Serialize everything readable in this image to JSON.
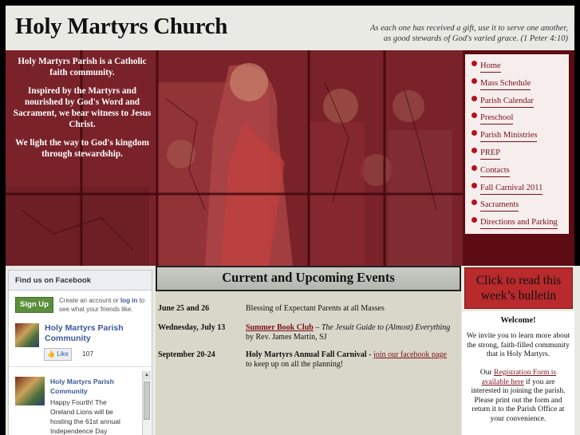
{
  "header": {
    "title": "Holy Martyrs Church",
    "quote_line1": "As each one has received a gift, use it to serve one another,",
    "quote_line2": "as good stewards of God's varied grace. (1 Peter 4:10)"
  },
  "mission": {
    "p1": "Holy Martyrs Parish is a Catholic faith community.",
    "p2": "Inspired by the Martyrs and nourished by God's Word and Sacrament, we bear witness to Jesus Christ.",
    "p3": "We light the way to God's kingdom through stewardship."
  },
  "nav": {
    "items": [
      {
        "label": "Home"
      },
      {
        "label": "Mass Schedule"
      },
      {
        "label": "Parish Calendar"
      },
      {
        "label": "Preschool"
      },
      {
        "label": "Parish Ministries"
      },
      {
        "label": "PREP"
      },
      {
        "label": "Contacts"
      },
      {
        "label": "Fall Carnival 2011"
      },
      {
        "label": "Sacraments"
      },
      {
        "label": "Directions and Parking"
      }
    ]
  },
  "facebook": {
    "heading": "Find us on Facebook",
    "signup_label": "Sign Up",
    "create_text": "Create an account or",
    "login_label": "log in",
    "create_text2": "to see what your friends like.",
    "page_name": "Holy Martyrs Parish Community",
    "like_label": "Like",
    "like_count": "107",
    "post_author": "Holy Martyrs Parish Community",
    "post_text": "Happy Fourth! The Oreland Lions will be hosting the 61st annual Independence Day Parade on Monday"
  },
  "events": {
    "title": "Current and Upcoming Events",
    "list": [
      {
        "date": "June 25 and 26",
        "text": "Blessing of Expectant Parents at all Masses"
      },
      {
        "date": "Wednesday, July 13",
        "link": "Summer Book Club",
        "dash": " – ",
        "italic": "The Jesuit Guide to (Almost) Everything",
        "rest": " by Rev. James Martin, SJ"
      },
      {
        "date": "September 20-24",
        "bold": "Holy Martyrs Annual Fall Carnival",
        "dash": " - ",
        "link": "join our facebook page",
        "rest": " to keep up on all the planning!"
      }
    ]
  },
  "bulletin": {
    "label_line1": "Click to read this",
    "label_line2": "week’s bulletin"
  },
  "welcome": {
    "title": "Welcome!",
    "text1": "We invite you to learn more about the strong, faith-filled community that is Holy Martyrs.",
    "text2a": "Our ",
    "link": "Registration Form is available here",
    "text2b": " if you are interested in joining the parish. Please print out the form and return it to the Parish Office at your convenience."
  }
}
